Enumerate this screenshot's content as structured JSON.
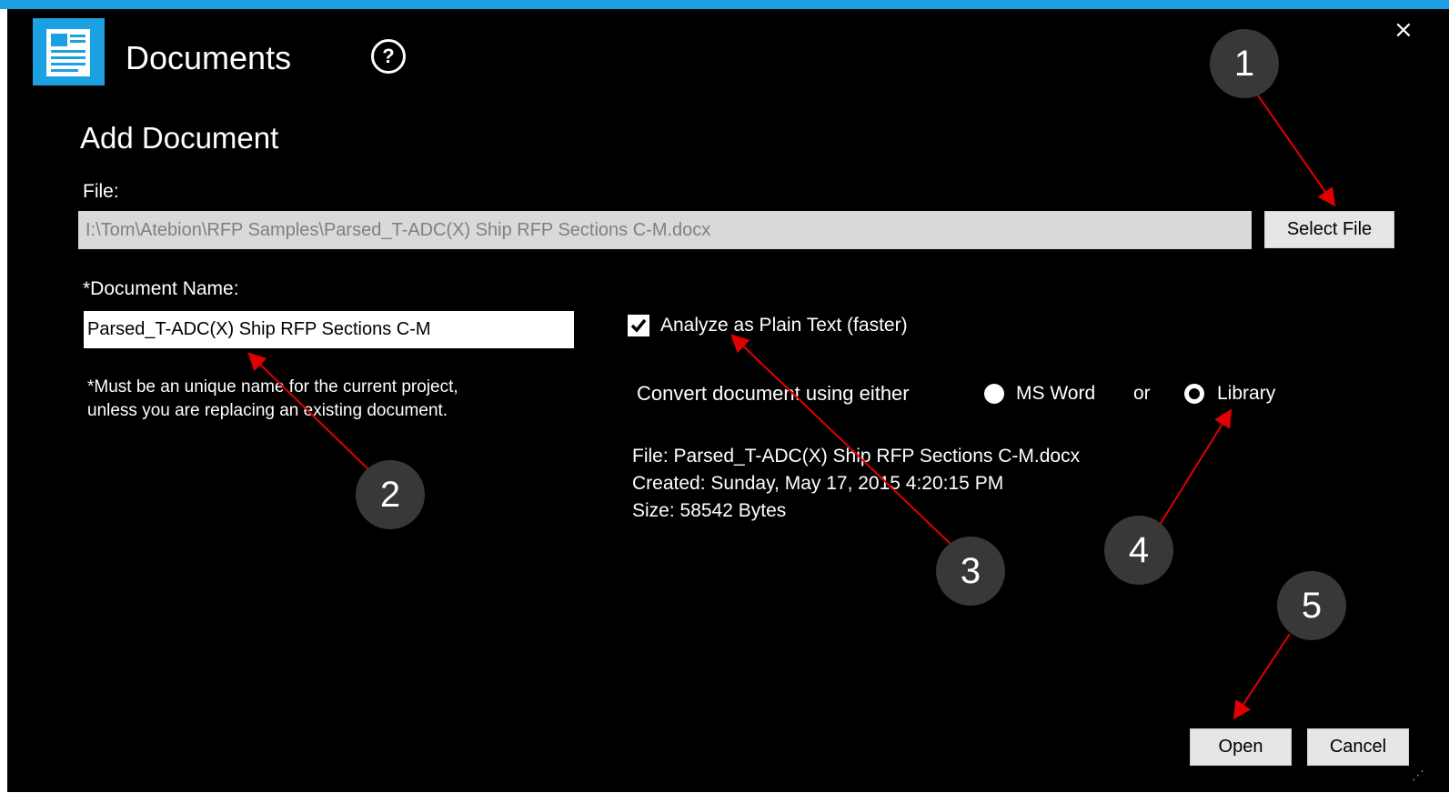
{
  "window": {
    "title": "Documents",
    "help_icon_glyph": "?",
    "close_glyph": "×",
    "accent_color": "#1ba1e2"
  },
  "form": {
    "heading": "Add Document",
    "file_label": "File:",
    "file_path": "I:\\Tom\\Atebion\\RFP Samples\\Parsed_T-ADC(X) Ship RFP Sections C-M.docx",
    "select_file_label": "Select File",
    "doc_name_label": "*Document Name:",
    "doc_name_value": "Parsed_T-ADC(X) Ship RFP Sections C-M",
    "note_line1": "*Must be an unique name for the current project,",
    "note_line2": "unless you are replacing an existing document.",
    "analyze_plain_text_label": "Analyze as Plain Text (faster)",
    "analyze_plain_text_checked": true,
    "convert_label": "Convert document using either",
    "option_msword": "MS Word",
    "or_label": "or",
    "option_library": "Library",
    "selected_converter": "Library"
  },
  "file_info": {
    "file": "File: Parsed_T-ADC(X) Ship RFP Sections C-M.docx",
    "created": "Created: Sunday, May 17, 2015 4:20:15 PM",
    "size": "Size: 58542 Bytes"
  },
  "buttons": {
    "open": "Open",
    "cancel": "Cancel"
  },
  "callouts": [
    "1",
    "2",
    "3",
    "4",
    "5"
  ],
  "annotation_arrow_color": "#e00000"
}
